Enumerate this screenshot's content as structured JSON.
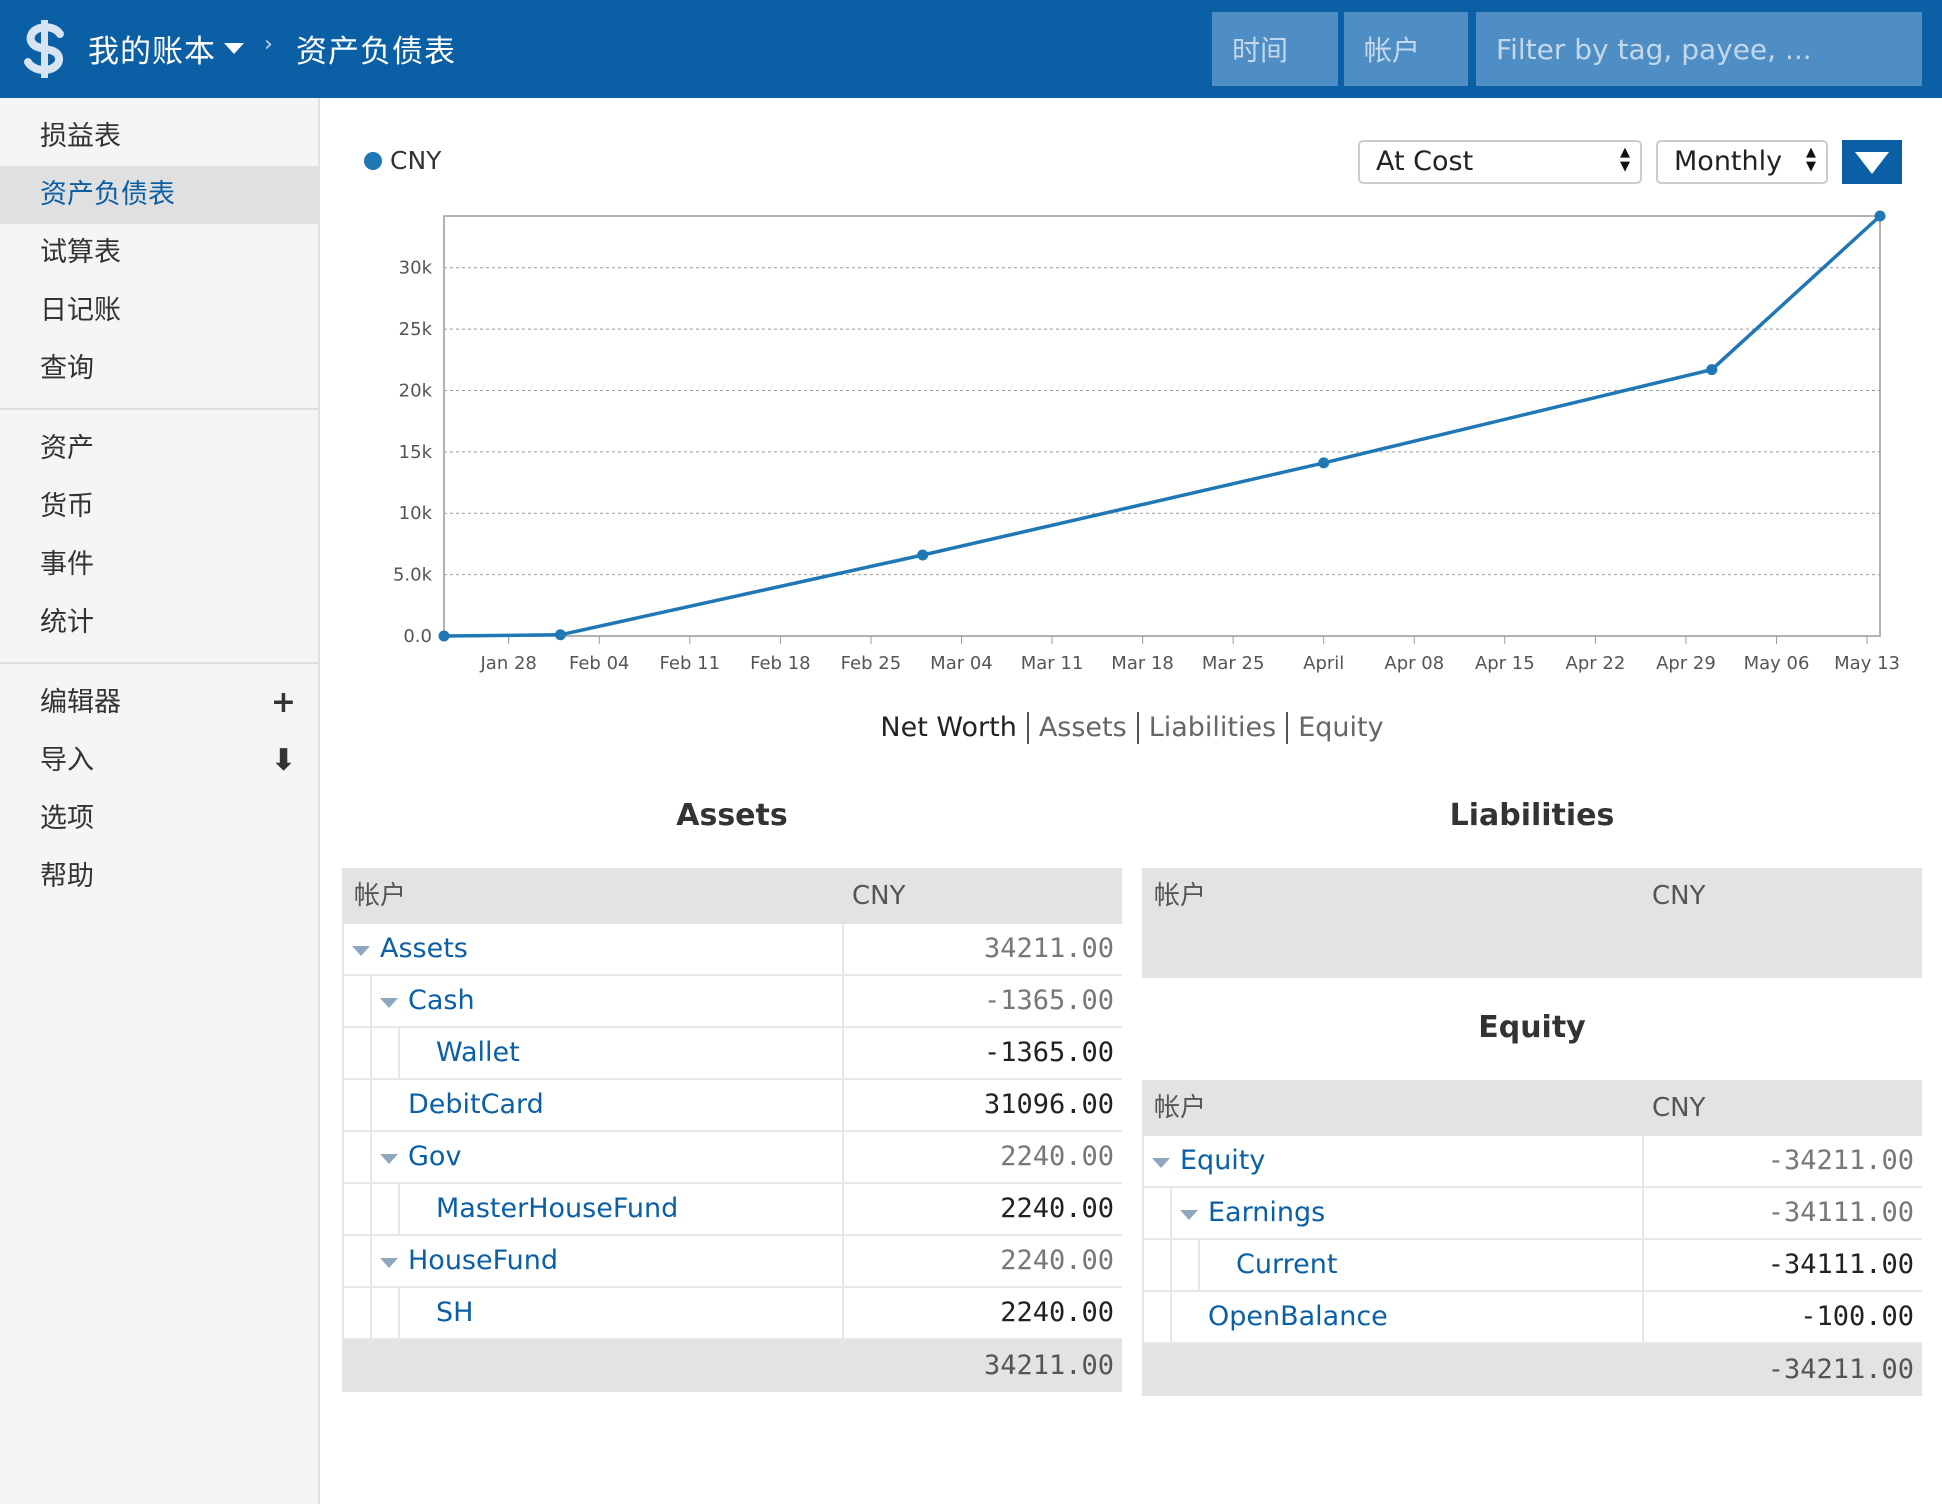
{
  "header": {
    "ledger_name": "我的账本",
    "breadcrumb_separator": "›",
    "page_title": "资产负债表",
    "time_filter": "时间",
    "account_filter": "帐户",
    "filter_placeholder": "Filter by tag, payee, ..."
  },
  "sidebar": {
    "groups": [
      {
        "items": [
          {
            "label": "损益表",
            "active": false
          },
          {
            "label": "资产负债表",
            "active": true
          },
          {
            "label": "试算表",
            "active": false
          },
          {
            "label": "日记账",
            "active": false
          },
          {
            "label": "查询",
            "active": false
          }
        ]
      },
      {
        "items": [
          {
            "label": "资产"
          },
          {
            "label": "货币"
          },
          {
            "label": "事件"
          },
          {
            "label": "统计"
          }
        ]
      },
      {
        "items": [
          {
            "label": "编辑器",
            "action": "+"
          },
          {
            "label": "导入",
            "action": "⬇"
          },
          {
            "label": "选项"
          },
          {
            "label": "帮助"
          }
        ]
      }
    ]
  },
  "controls": {
    "conversion": "At Cost",
    "interval": "Monthly",
    "legend_currency": "CNY"
  },
  "chart_tabs": [
    "Net Worth",
    "Assets",
    "Liabilities",
    "Equity"
  ],
  "chart_data": {
    "type": "line",
    "series": [
      {
        "name": "CNY",
        "points": [
          {
            "x": "2018-01-23",
            "y": 0
          },
          {
            "x": "2018-02-01",
            "y": 100
          },
          {
            "x": "2018-03-01",
            "y": 6600
          },
          {
            "x": "2018-04-01",
            "y": 14100
          },
          {
            "x": "2018-05-01",
            "y": 21700
          },
          {
            "x": "2018-05-14",
            "y": 34211
          }
        ]
      }
    ],
    "x_ticks": [
      "Jan 28",
      "Feb 04",
      "Feb 11",
      "Feb 18",
      "Feb 25",
      "Mar 04",
      "Mar 11",
      "Mar 18",
      "Mar 25",
      "April",
      "Apr 08",
      "Apr 15",
      "Apr 22",
      "Apr 29",
      "May 06",
      "May 13"
    ],
    "y_ticks": [
      "0.0",
      "5.0k",
      "10k",
      "15k",
      "20k",
      "25k",
      "30k"
    ],
    "ylim": [
      0,
      34211
    ],
    "grid": true,
    "color": "#1f77b4"
  },
  "assets": {
    "title": "Assets",
    "col_account": "帐户",
    "col_currency": "CNY",
    "rows": [
      {
        "name": "Assets",
        "depth": 0,
        "toggle": true,
        "value": "34211.00",
        "light": true
      },
      {
        "name": "Cash",
        "depth": 1,
        "toggle": true,
        "value": "-1365.00",
        "light": true
      },
      {
        "name": "Wallet",
        "depth": 2,
        "toggle": false,
        "value": "-1365.00",
        "light": false
      },
      {
        "name": "DebitCard",
        "depth": 1,
        "toggle": false,
        "value": "31096.00",
        "light": false
      },
      {
        "name": "Gov",
        "depth": 1,
        "toggle": true,
        "value": "2240.00",
        "light": true
      },
      {
        "name": "MasterHouseFund",
        "depth": 2,
        "toggle": false,
        "value": "2240.00",
        "light": false
      },
      {
        "name": "HouseFund",
        "depth": 1,
        "toggle": true,
        "value": "2240.00",
        "light": true
      },
      {
        "name": "SH",
        "depth": 2,
        "toggle": false,
        "value": "2240.00",
        "light": false
      }
    ],
    "total": "34211.00"
  },
  "liabilities": {
    "title": "Liabilities",
    "col_account": "帐户",
    "col_currency": "CNY"
  },
  "equity": {
    "title": "Equity",
    "col_account": "帐户",
    "col_currency": "CNY",
    "rows": [
      {
        "name": "Equity",
        "depth": 0,
        "toggle": true,
        "value": "-34211.00",
        "light": true
      },
      {
        "name": "Earnings",
        "depth": 1,
        "toggle": true,
        "value": "-34111.00",
        "light": true
      },
      {
        "name": "Current",
        "depth": 2,
        "toggle": false,
        "value": "-34111.00",
        "light": false
      },
      {
        "name": "OpenBalance",
        "depth": 1,
        "toggle": false,
        "value": "-100.00",
        "light": false
      }
    ],
    "total": "-34211.00"
  }
}
